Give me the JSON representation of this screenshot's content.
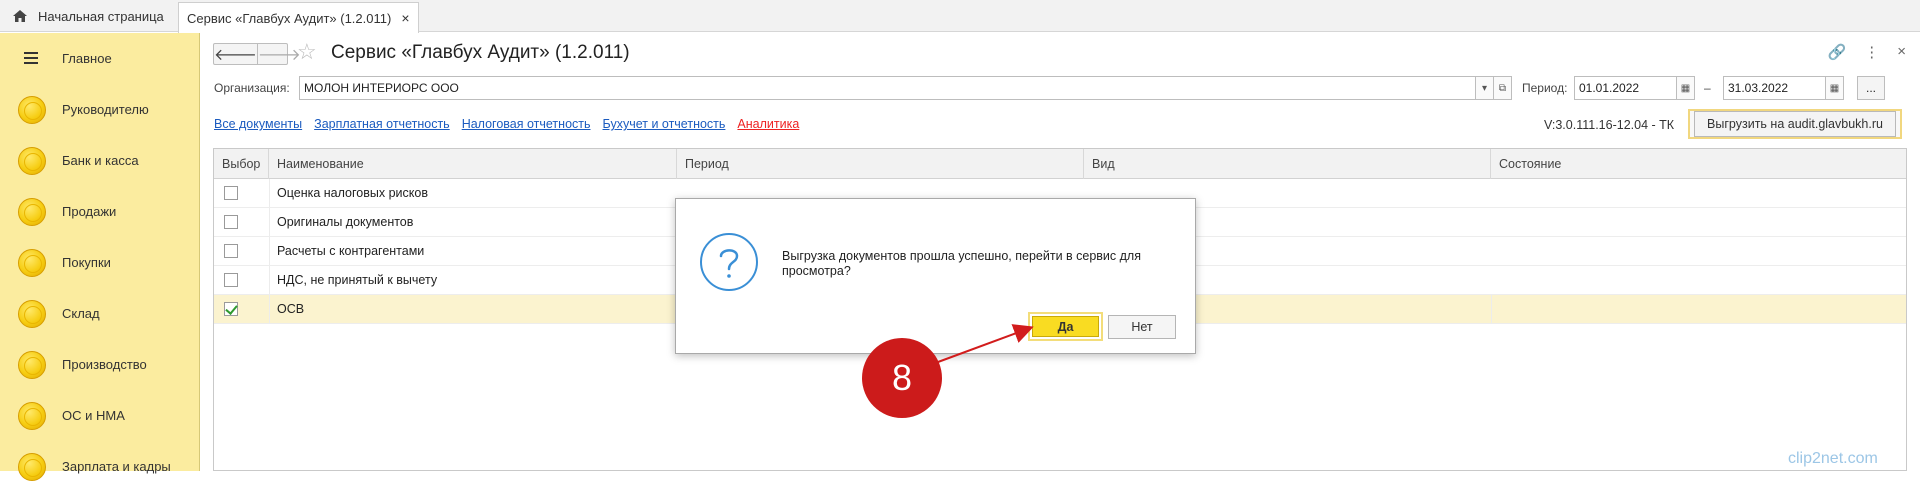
{
  "tabs": {
    "home_label": "Начальная страница",
    "active_label": "Сервис «Главбух Аудит» (1.2.011)",
    "close": "×"
  },
  "sidebar": {
    "items": [
      {
        "label": "Главное",
        "icon": "menu-icon"
      },
      {
        "label": "Руководителю",
        "icon": "coin-icon"
      },
      {
        "label": "Банк и касса",
        "icon": "coin-icon"
      },
      {
        "label": "Продажи",
        "icon": "coin-icon"
      },
      {
        "label": "Покупки",
        "icon": "coin-icon"
      },
      {
        "label": "Склад",
        "icon": "coin-icon"
      },
      {
        "label": "Производство",
        "icon": "coin-icon"
      },
      {
        "label": "ОС и НМА",
        "icon": "coin-icon"
      },
      {
        "label": "Зарплата и кадры",
        "icon": "coin-icon"
      }
    ]
  },
  "header": {
    "back": "🡐",
    "forward": "🡒",
    "star": "☆",
    "title": "Сервис «Главбух Аудит» (1.2.011)",
    "link_icon": "🔗",
    "more_icon": "⋮",
    "close_icon": "×"
  },
  "filters": {
    "org_label": "Организация:",
    "org_value": "МОЛОН ИНТЕРИОРС ООО",
    "period_label": "Период:",
    "period_from": "01.01.2022",
    "dash": "–",
    "period_to": "31.03.2022",
    "ellipsis": "..."
  },
  "links": [
    {
      "label": "Все документы"
    },
    {
      "label": "Зарплатная отчетность"
    },
    {
      "label": "Налоговая отчетность"
    },
    {
      "label": "Бухучет и отчетность"
    },
    {
      "label": "Аналитика"
    }
  ],
  "version": "V:3.0.111.16-12.04 -  ТК",
  "export_button": "Выгрузить на audit.glavbukh.ru",
  "table": {
    "columns": [
      "Выбор",
      "Наименование",
      "Период",
      "Вид",
      "Состояние"
    ],
    "rows": [
      {
        "name": "Оценка налоговых рисков",
        "checked": false
      },
      {
        "name": "Оригиналы документов",
        "checked": false
      },
      {
        "name": "Расчеты с контрагентами",
        "checked": false
      },
      {
        "name": "НДС, не принятый к вычету",
        "checked": false
      },
      {
        "name": "ОСВ",
        "checked": true
      }
    ]
  },
  "dialog": {
    "message": "Выгрузка документов прошла успешно, перейти в сервис для просмотра?",
    "yes": "Да",
    "no": "Нет"
  },
  "annotation": {
    "step": "8"
  },
  "watermark": "clip2net.com",
  "colors": {
    "sidebar_bg": "#fbec9f",
    "accent_yellow": "#f9dc22",
    "link_blue": "#1b5bbf",
    "link_red": "#e22222",
    "step_red": "#cc1b1b"
  }
}
